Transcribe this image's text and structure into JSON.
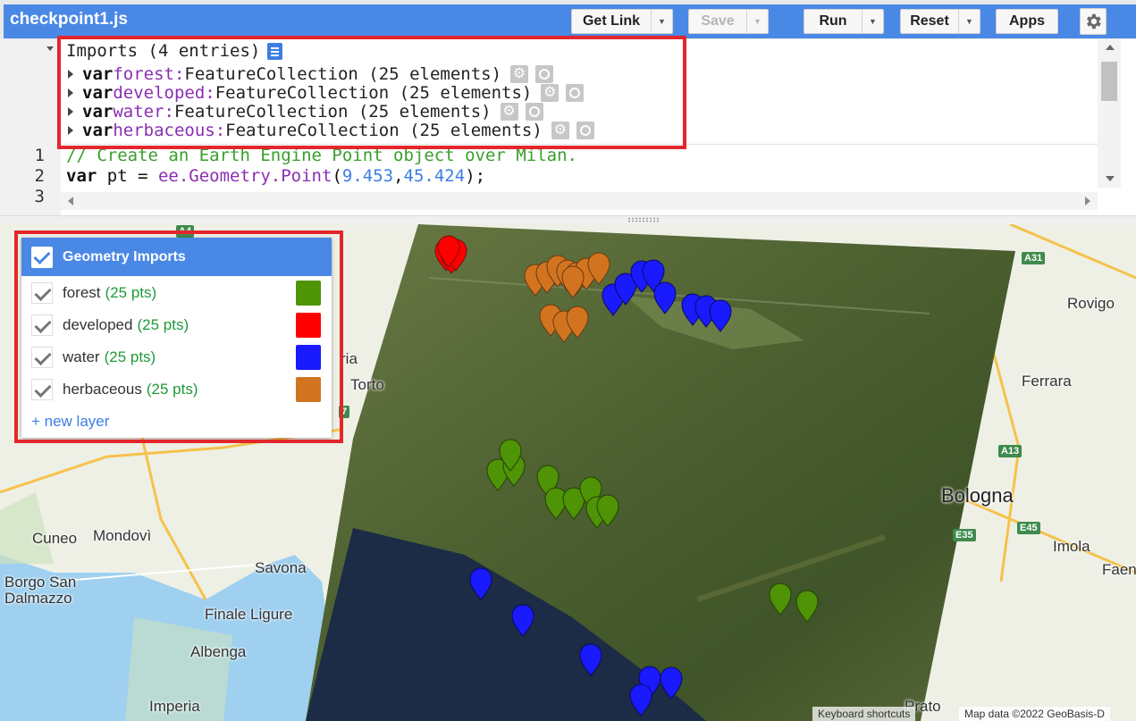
{
  "app": {
    "title": "checkpoint1.js"
  },
  "toolbar": {
    "get_link": "Get Link",
    "save": "Save",
    "run": "Run",
    "reset": "Reset",
    "apps": "Apps"
  },
  "imports": {
    "header": "Imports (4 entries)",
    "entries": [
      {
        "keyword": "var",
        "name": "forest:",
        "type": "FeatureCollection (25 elements)"
      },
      {
        "keyword": "var",
        "name": "developed:",
        "type": "FeatureCollection (25 elements)"
      },
      {
        "keyword": "var",
        "name": "water:",
        "type": "FeatureCollection (25 elements)"
      },
      {
        "keyword": "var",
        "name": "herbaceous:",
        "type": "FeatureCollection (25 elements)"
      }
    ]
  },
  "code": {
    "line_numbers": [
      "1",
      "2",
      "3"
    ],
    "line1_comment": "// Create an Earth Engine Point object over Milan.",
    "line2_kw": "var",
    "line2_a": " pt = ",
    "line2_fn": "ee.Geometry.Point",
    "line2_open": "(",
    "line2_n1": "9.453",
    "line2_comma": ",",
    "line2_n2": "45.424",
    "line2_close": ");"
  },
  "layers_panel": {
    "title": "Geometry Imports",
    "layers": [
      {
        "name": "forest",
        "count": "(25 pts)",
        "color": "#4f9306"
      },
      {
        "name": "developed",
        "count": "(25 pts)",
        "color": "#ff0000"
      },
      {
        "name": "water",
        "count": "(25 pts)",
        "color": "#1a1aff"
      },
      {
        "name": "herbaceous",
        "count": "(25 pts)",
        "color": "#d2741f"
      }
    ],
    "new_layer": "+ new layer"
  },
  "map": {
    "places": [
      "Rovigo",
      "Ferrara",
      "Bologna",
      "Imola",
      "Faenza",
      "Cuneo",
      "Mondovì",
      "Savona",
      "Borgo San",
      "Dalmazzo",
      "Finale Ligure",
      "Albenga",
      "Imperia",
      "Prato",
      "Torto",
      "ria"
    ],
    "road_shields": [
      "A31",
      "A13",
      "E35",
      "E45",
      "A4",
      "7"
    ],
    "attribution_keyboard": "Keyboard shortcuts",
    "attribution_data": "Map data ©2022 GeoBasis-D"
  }
}
